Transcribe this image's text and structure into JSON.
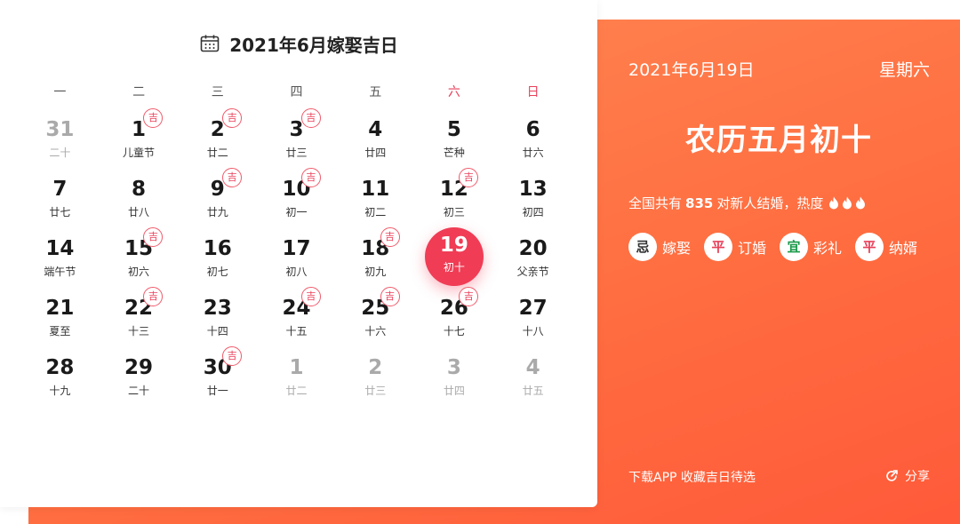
{
  "calendar": {
    "title": "2021年6月嫁娶吉日",
    "ji_label": "吉",
    "weekdays": [
      {
        "label": "一",
        "weekend": false
      },
      {
        "label": "二",
        "weekend": false
      },
      {
        "label": "三",
        "weekend": false
      },
      {
        "label": "四",
        "weekend": false
      },
      {
        "label": "五",
        "weekend": false
      },
      {
        "label": "六",
        "weekend": true
      },
      {
        "label": "日",
        "weekend": true
      }
    ],
    "days": [
      {
        "num": "31",
        "sub": "二十",
        "other": true,
        "ji": false
      },
      {
        "num": "1",
        "sub": "儿童节",
        "other": false,
        "ji": true
      },
      {
        "num": "2",
        "sub": "廿二",
        "other": false,
        "ji": true
      },
      {
        "num": "3",
        "sub": "廿三",
        "other": false,
        "ji": true
      },
      {
        "num": "4",
        "sub": "廿四",
        "other": false,
        "ji": false
      },
      {
        "num": "5",
        "sub": "芒种",
        "other": false,
        "ji": false
      },
      {
        "num": "6",
        "sub": "廿六",
        "other": false,
        "ji": false
      },
      {
        "num": "7",
        "sub": "廿七",
        "other": false,
        "ji": false
      },
      {
        "num": "8",
        "sub": "廿八",
        "other": false,
        "ji": false
      },
      {
        "num": "9",
        "sub": "廿九",
        "other": false,
        "ji": true
      },
      {
        "num": "10",
        "sub": "初一",
        "other": false,
        "ji": true
      },
      {
        "num": "11",
        "sub": "初二",
        "other": false,
        "ji": false
      },
      {
        "num": "12",
        "sub": "初三",
        "other": false,
        "ji": true
      },
      {
        "num": "13",
        "sub": "初四",
        "other": false,
        "ji": false
      },
      {
        "num": "14",
        "sub": "端午节",
        "other": false,
        "ji": false
      },
      {
        "num": "15",
        "sub": "初六",
        "other": false,
        "ji": true
      },
      {
        "num": "16",
        "sub": "初七",
        "other": false,
        "ji": false
      },
      {
        "num": "17",
        "sub": "初八",
        "other": false,
        "ji": false
      },
      {
        "num": "18",
        "sub": "初九",
        "other": false,
        "ji": true
      },
      {
        "num": "19",
        "sub": "初十",
        "other": false,
        "ji": false,
        "selected": true
      },
      {
        "num": "20",
        "sub": "父亲节",
        "other": false,
        "ji": false
      },
      {
        "num": "21",
        "sub": "夏至",
        "other": false,
        "ji": false
      },
      {
        "num": "22",
        "sub": "十三",
        "other": false,
        "ji": true
      },
      {
        "num": "23",
        "sub": "十四",
        "other": false,
        "ji": false
      },
      {
        "num": "24",
        "sub": "十五",
        "other": false,
        "ji": true
      },
      {
        "num": "25",
        "sub": "十六",
        "other": false,
        "ji": true
      },
      {
        "num": "26",
        "sub": "十七",
        "other": false,
        "ji": true
      },
      {
        "num": "27",
        "sub": "十八",
        "other": false,
        "ji": false
      },
      {
        "num": "28",
        "sub": "十九",
        "other": false,
        "ji": false
      },
      {
        "num": "29",
        "sub": "二十",
        "other": false,
        "ji": false
      },
      {
        "num": "30",
        "sub": "廿一",
        "other": false,
        "ji": true
      },
      {
        "num": "1",
        "sub": "廿二",
        "other": true,
        "ji": false
      },
      {
        "num": "2",
        "sub": "廿三",
        "other": true,
        "ji": false
      },
      {
        "num": "3",
        "sub": "廿四",
        "other": true,
        "ji": false
      },
      {
        "num": "4",
        "sub": "廿五",
        "other": true,
        "ji": false
      }
    ]
  },
  "detail": {
    "date": "2021年6月19日",
    "weekday": "星期六",
    "lunar": "农历五月初十",
    "stat_prefix": "全国共有",
    "stat_count": "835",
    "stat_suffix": "对新人结婚，热度",
    "flame_count": 3,
    "tags": [
      {
        "badge": "忌",
        "label": "嫁娶",
        "kind": "ji-bad"
      },
      {
        "badge": "平",
        "label": "订婚",
        "kind": "ping"
      },
      {
        "badge": "宜",
        "label": "彩礼",
        "kind": "yi"
      },
      {
        "badge": "平",
        "label": "纳婿",
        "kind": "ping"
      }
    ],
    "download": "下载APP 收藏吉日待选",
    "share": "分享"
  },
  "colors": {
    "accent": "#f03c55",
    "orange": "#ff6d40"
  }
}
